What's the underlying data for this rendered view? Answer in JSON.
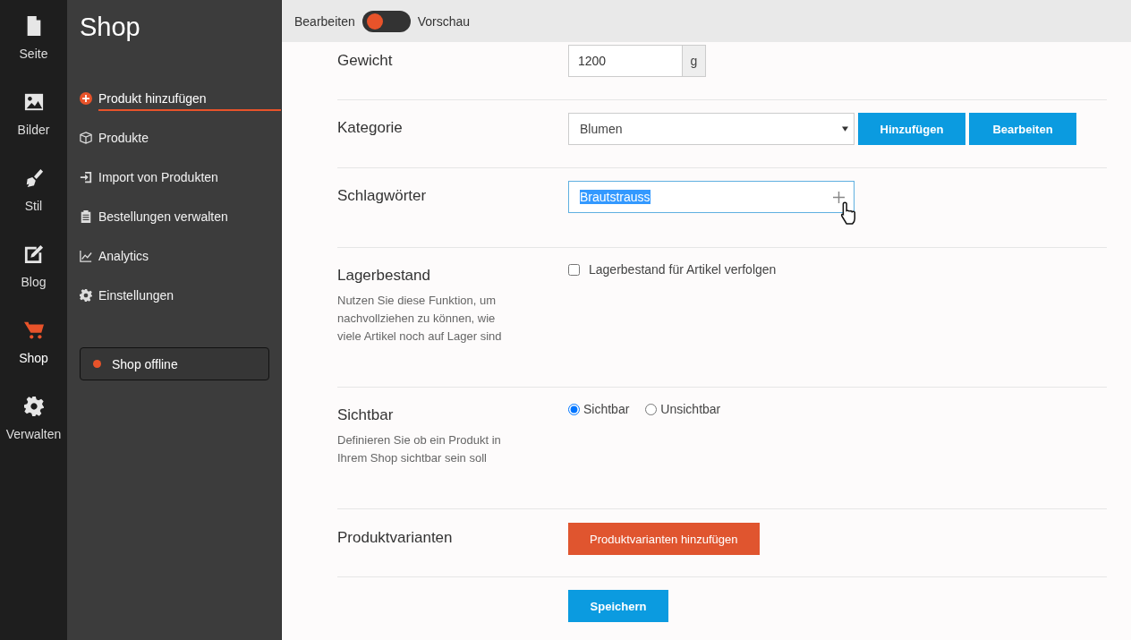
{
  "rail": [
    {
      "label": "Seite",
      "selected": false
    },
    {
      "label": "Bilder",
      "selected": false
    },
    {
      "label": "Stil",
      "selected": false
    },
    {
      "label": "Blog",
      "selected": false
    },
    {
      "label": "Shop",
      "selected": true
    },
    {
      "label": "Verwalten",
      "selected": false
    }
  ],
  "sidebar": {
    "title": "Shop",
    "items": [
      {
        "label": "Produkt hinzufügen",
        "selected": true
      },
      {
        "label": "Produkte",
        "selected": false
      },
      {
        "label": "Import von Produkten",
        "selected": false
      },
      {
        "label": "Bestellungen verwalten",
        "selected": false
      },
      {
        "label": "Analytics",
        "selected": false
      },
      {
        "label": "Einstellungen",
        "selected": false
      }
    ],
    "status_button": {
      "label": "Shop offline",
      "color": "#e8532a"
    }
  },
  "topbar": {
    "left_label": "Bearbeiten",
    "right_label": "Vorschau",
    "toggle_on": false
  },
  "form": {
    "weight": {
      "label": "Gewicht",
      "value": "1200",
      "unit": "g"
    },
    "category": {
      "label": "Kategorie",
      "value": "Blumen",
      "buttons": [
        "Hinzufügen",
        "Bearbeiten"
      ]
    },
    "tags": {
      "label": "Schlagwörter",
      "value": "Brautstrauss",
      "text_selected": true
    },
    "stock": {
      "label": "Lagerbestand",
      "description": "Nutzen Sie diese Funktion, um nachvollziehen zu können, wie viele Artikel noch auf Lager sind",
      "checkbox_label": "Lagerbestand für Artikel verfolgen",
      "checked": false
    },
    "visibility": {
      "label": "Sichtbar",
      "description": "Definieren Sie ob ein Produkt in Ihrem Shop sichtbar sein soll",
      "options": [
        {
          "label": "Sichtbar",
          "selected": true
        },
        {
          "label": "Unsichtbar",
          "selected": false
        }
      ]
    },
    "variants": {
      "label": "Produktvarianten",
      "button": "Produktvarianten hinzufügen"
    },
    "save_button": "Speichern"
  }
}
